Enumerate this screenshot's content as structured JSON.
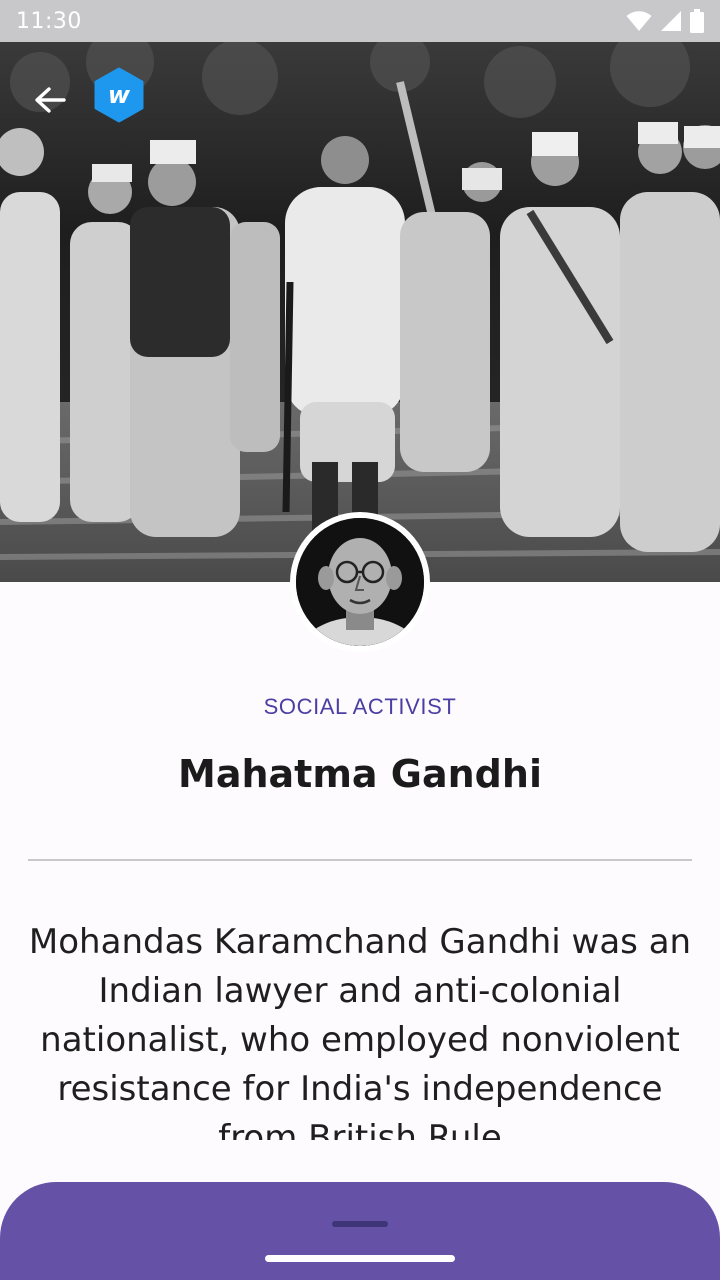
{
  "status_bar": {
    "time": "11:30",
    "icons": [
      "wifi-icon",
      "signal-icon",
      "battery-icon"
    ]
  },
  "header": {
    "back_icon": "arrow-left-icon",
    "logo_letter": "w",
    "logo_color": "#1e97ee"
  },
  "profile": {
    "category": "SOCIAL ACTIVIST",
    "name": "Mahatma Gandhi",
    "bio": "Mohandas Karamchand Gandhi was an Indian lawyer and anti-colonial nationalist,  who employed nonviolent resistance for India's independence from British Rule"
  },
  "colors": {
    "accent": "#4b3fa3",
    "sheet": "#6552a6",
    "background": "#fdfbfd"
  }
}
